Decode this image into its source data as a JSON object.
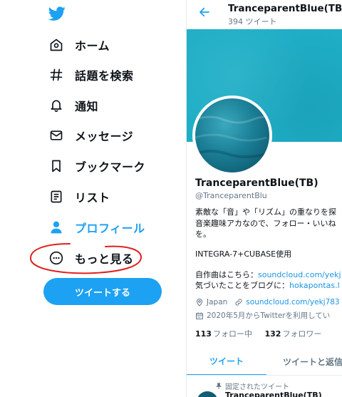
{
  "nav": {
    "items": [
      {
        "label": "ホーム",
        "icon": "home-icon"
      },
      {
        "label": "話題を検索",
        "icon": "hashtag-icon"
      },
      {
        "label": "通知",
        "icon": "bell-icon"
      },
      {
        "label": "メッセージ",
        "icon": "envelope-icon"
      },
      {
        "label": "ブックマーク",
        "icon": "bookmark-icon"
      },
      {
        "label": "リスト",
        "icon": "list-icon"
      },
      {
        "label": "プロフィール",
        "icon": "person-icon"
      },
      {
        "label": "もっと見る",
        "icon": "more-icon"
      }
    ],
    "tweet_button": "ツイートする"
  },
  "profile": {
    "header_name": "TranceparentBlue(TB)",
    "header_count": "394 ツイート",
    "name": "TranceparentBlue(TB)",
    "handle": "@TranceparentBlu",
    "bio_line1": "素敵な「音」や「リズム」の重なりを探",
    "bio_line2": "音楽趣味アカなので、フォロー・いいね",
    "bio_line3": "を。",
    "bio_line4": "INTEGRA-7+CUBASE使用",
    "bio_line5_prefix": "自作曲はこちら：",
    "bio_line5_link": "soundcloud.com/yekj",
    "bio_line6_prefix": "気づいたことをブログに：",
    "bio_line6_link": "hokapontas.l",
    "location": "Japan",
    "website": "soundcloud.com/yekj783",
    "joined": "2020年5月からTwitterを利用してい",
    "following_count": "113",
    "following_label": "フォロー中",
    "followers_count": "132",
    "followers_label": "フォロワー",
    "tab_tweets": "ツイート",
    "tab_replies": "ツイートと返信",
    "pinned_label": "固定されたツイート",
    "pinned_author": "TranceparentBlue(TB)"
  },
  "colors": {
    "accent": "#1da1f2",
    "annotation": "#e0201f",
    "banner": "#1eaec6"
  }
}
